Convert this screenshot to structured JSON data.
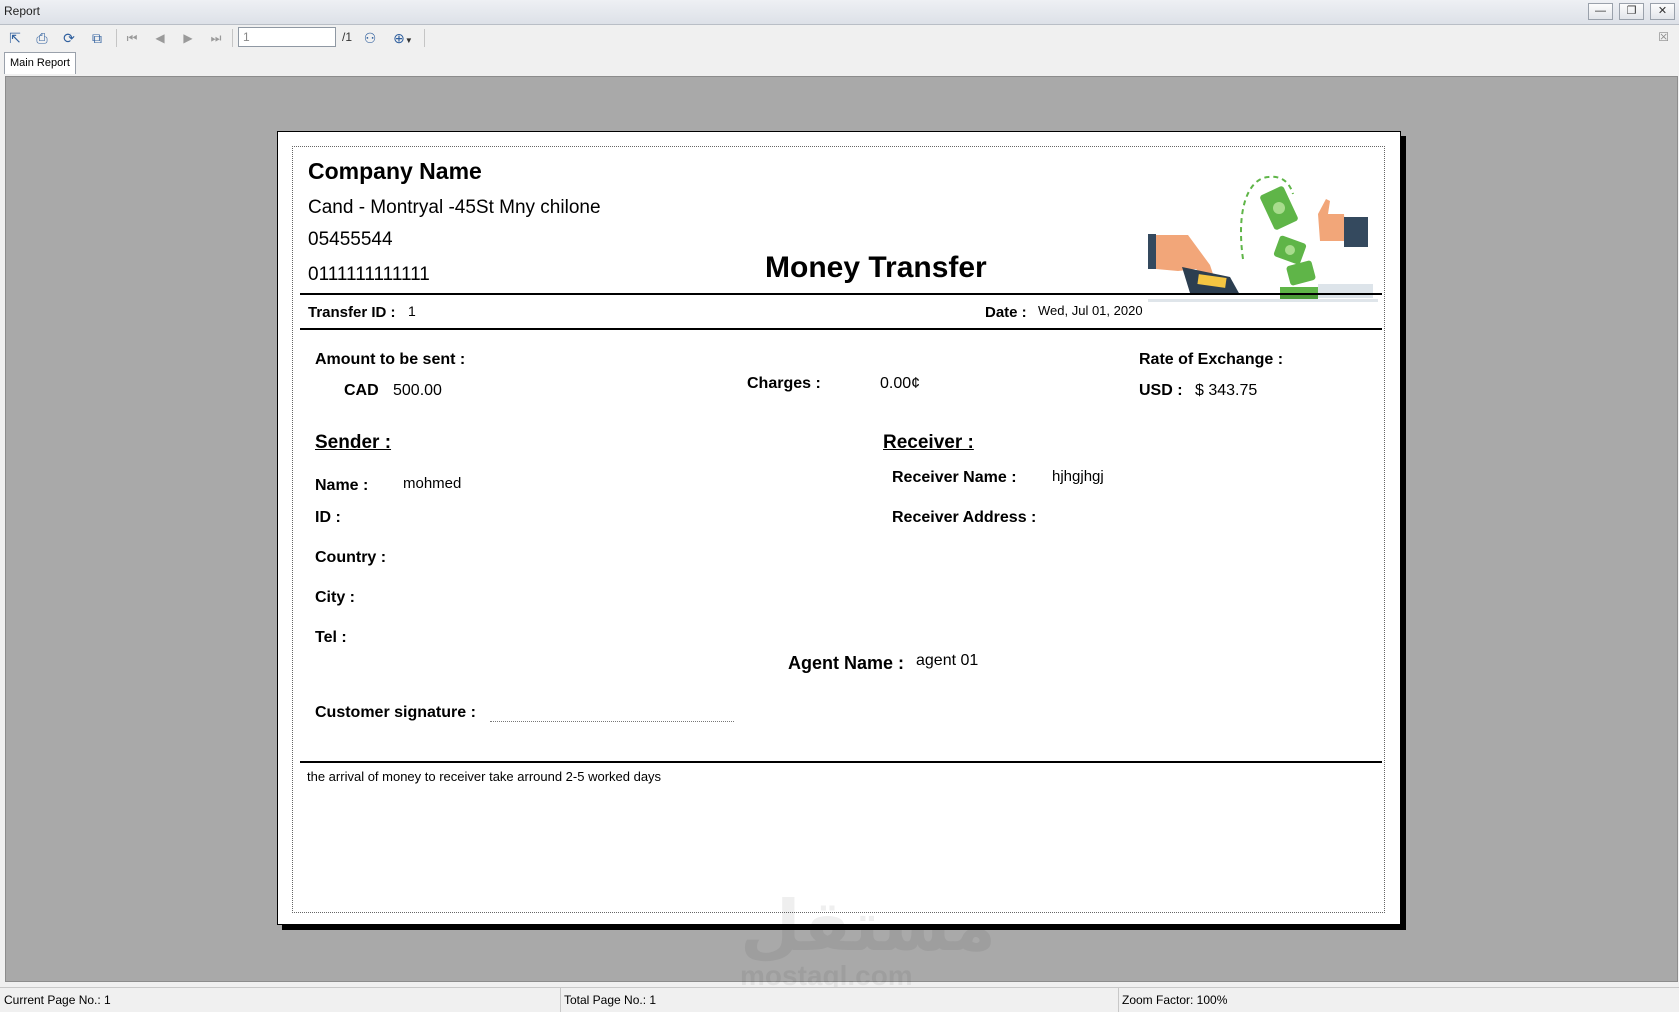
{
  "window": {
    "title": "Report"
  },
  "toolbar": {
    "page_value": "1",
    "page_total": "/1",
    "icons": [
      "export-icon",
      "print-icon",
      "refresh-icon",
      "copy-icon",
      "first-page-icon",
      "prev-page-icon",
      "next-page-icon",
      "last-page-icon",
      "find-icon",
      "zoom-icon"
    ]
  },
  "tabs": [
    {
      "label": "Main Report"
    }
  ],
  "report": {
    "company_name": "Company Name",
    "address": "Cand - Montryal -45St Mny chilone",
    "phone1": "05455544",
    "phone2": "0111111111111",
    "title": "Money Transfer",
    "transfer_id_label": "Transfer ID :",
    "transfer_id": "1",
    "date_label": "Date :",
    "date": "Wed, Jul 01, 2020",
    "amount_label": "Amount to be sent :",
    "currency": "CAD",
    "amount": "500.00",
    "charges_label": "Charges :",
    "charges": "0.00¢",
    "rate_label": "Rate of Exchange :",
    "usd_label": "USD :",
    "usd_value": "$ 343.75",
    "sender_heading": "Sender :",
    "receiver_heading": "Receiver :",
    "name_label": "Name :",
    "name": "mohmed",
    "id_label": "ID :",
    "country_label": "Country :",
    "city_label": "City :",
    "tel_label": "Tel :",
    "receiver_name_label": "Receiver Name :",
    "receiver_name": "hjhgjhgj",
    "receiver_address_label": "Receiver Address :",
    "agent_label": "Agent Name :",
    "agent_name": "agent 01",
    "signature_label": "Customer signature :",
    "footnote": "the arrival of money to receiver take arround 2-5 worked days"
  },
  "watermark": {
    "arabic": "مستقل",
    "latin": "mostaql.com"
  },
  "status": {
    "current_page": "Current Page No.: 1",
    "total_page": "Total Page No.: 1",
    "zoom": "Zoom Factor: 100%"
  },
  "colors": {
    "viewer_bg": "#a9a9a9",
    "money_green": "#5fb548",
    "sleeve_navy": "#34495e"
  }
}
